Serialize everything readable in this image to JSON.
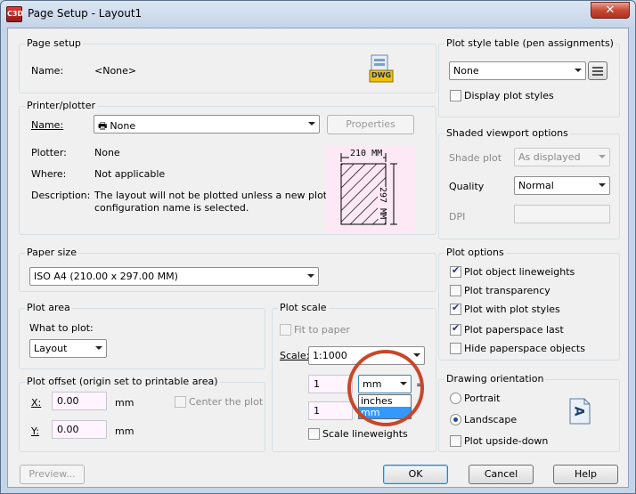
{
  "window": {
    "title": "Page Setup - Layout1",
    "app_icon_text": "C3D",
    "close_glyph": "✕"
  },
  "page_setup": {
    "group_label": "Page setup",
    "name_label": "Name:",
    "name_value": "<None>",
    "dwg_icon_text": "DWG"
  },
  "printer": {
    "group_label": "Printer/plotter",
    "name_label": "Name:",
    "name_value": "None",
    "properties_label": "Properties",
    "plotter_label": "Plotter:",
    "plotter_value": "None",
    "where_label": "Where:",
    "where_value": "Not applicable",
    "description_label": "Description:",
    "description_line1": "The layout will not be plotted unless a new plotter",
    "description_line2": "configuration name is selected.",
    "preview_width": "210 MM",
    "preview_height": "297 MM"
  },
  "paper_size": {
    "group_label": "Paper size",
    "value": "ISO A4 (210.00 x 297.00 MM)"
  },
  "plot_area": {
    "group_label": "Plot area",
    "what_label": "What to plot:",
    "what_value": "Layout"
  },
  "plot_offset": {
    "group_label": "Plot offset (origin set to printable area)",
    "x_label": "X:",
    "x_value": "0.00",
    "y_label": "Y:",
    "y_value": "0.00",
    "unit": "mm",
    "center_label": "Center the plot"
  },
  "plot_scale": {
    "group_label": "Plot scale",
    "fit_label": "Fit to paper",
    "scale_label": "Scale:",
    "scale_value": "1:1000",
    "top_value": "1",
    "unit_value": "mm",
    "equals": "=",
    "bottom_value": "1",
    "unit_options": [
      "inches",
      "mm"
    ],
    "lineweights_label": "Scale lineweights"
  },
  "plot_style": {
    "group_label": "Plot style table (pen assignments)",
    "value": "None",
    "display_label": "Display plot styles"
  },
  "shaded": {
    "group_label": "Shaded viewport options",
    "shade_label": "Shade plot",
    "shade_value": "As displayed",
    "quality_label": "Quality",
    "quality_value": "Normal",
    "dpi_label": "DPI"
  },
  "plot_options": {
    "group_label": "Plot options",
    "items": [
      "Plot object lineweights",
      "Plot transparency",
      "Plot with plot styles",
      "Plot paperspace last",
      "Hide paperspace objects"
    ]
  },
  "orientation": {
    "group_label": "Drawing orientation",
    "portrait_label": "Portrait",
    "landscape_label": "Landscape",
    "upside_label": "Plot upside-down",
    "icon_letter": "A"
  },
  "footer": {
    "preview_label": "Preview...",
    "ok_label": "OK",
    "cancel_label": "Cancel",
    "help_label": "Help"
  },
  "colors": {
    "accent_circle": "#c8462a",
    "selection": "#3399ff"
  }
}
